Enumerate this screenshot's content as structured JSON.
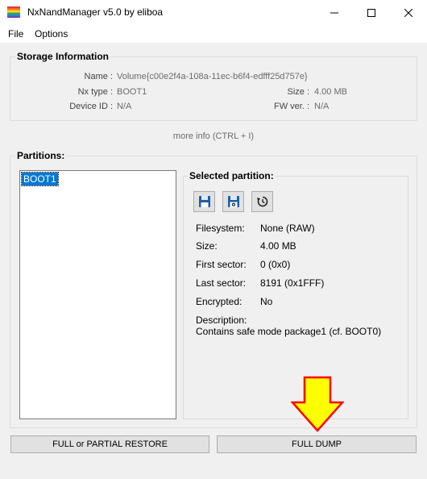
{
  "window": {
    "title": "NxNandManager v5.0 by eliboa"
  },
  "menu": {
    "file": "File",
    "options": "Options"
  },
  "storage": {
    "title": "Storage Information",
    "name_label": "Name :",
    "name_value": "Volume{c00e2f4a-108a-11ec-b6f4-edfff25d757e}",
    "nxtype_label": "Nx type :",
    "nxtype_value": "BOOT1",
    "size_label": "Size :",
    "size_value": "4.00 MB",
    "deviceid_label": "Device ID :",
    "deviceid_value": "N/A",
    "fwver_label": "FW ver. :",
    "fwver_value": "N/A"
  },
  "more_info": "more info (CTRL + I)",
  "partitions": {
    "title": "Partitions:",
    "items": [
      "BOOT1"
    ]
  },
  "selected": {
    "title": "Selected partition:",
    "icons": [
      "save-icon",
      "save-settings-icon",
      "restore-icon"
    ],
    "filesystem_label": "Filesystem:",
    "filesystem_value": "None (RAW)",
    "size_label": "Size:",
    "size_value": "4.00 MB",
    "first_sector_label": "First sector:",
    "first_sector_value": "0 (0x0)",
    "last_sector_label": "Last sector:",
    "last_sector_value": "8191 (0x1FFF)",
    "encrypted_label": "Encrypted:",
    "encrypted_value": "No",
    "description_label": "Description:",
    "description_value": "Contains safe mode package1 (cf. BOOT0)"
  },
  "buttons": {
    "restore": "FULL or PARTIAL RESTORE",
    "dump": "FULL DUMP"
  },
  "colors": {
    "selection": "#0078d7",
    "arrow": "#ffff00",
    "arrow_border": "#ff0000"
  }
}
